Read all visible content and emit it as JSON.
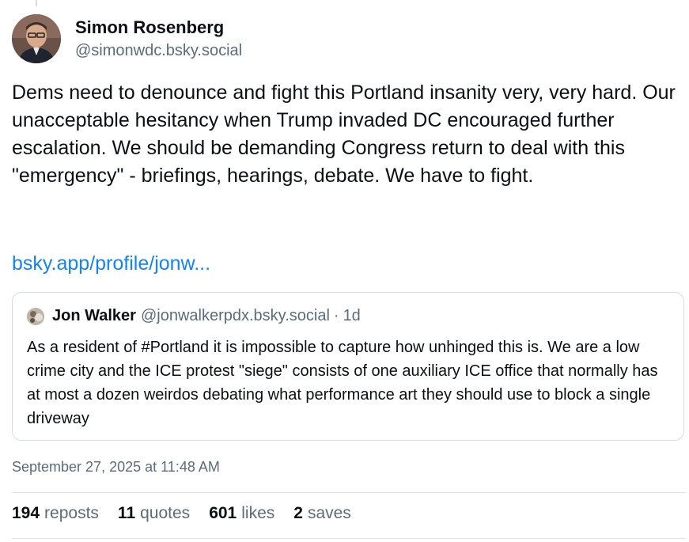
{
  "author": {
    "display_name": "Simon Rosenberg",
    "handle": "@simonwdc.bsky.social"
  },
  "post": {
    "paragraph": "Dems need to denounce and fight this Portland insanity very, very hard.  Our unacceptable hesitancy when Trump invaded DC encouraged further escalation.  We should be demanding Congress return to deal with this \"emergency\" - briefings, hearings, debate.  We have to fight.",
    "link_text": "bsky.app/profile/jonw..."
  },
  "quote": {
    "display_name": "Jon Walker",
    "handle": "@jonwalkerpdx.bsky.social",
    "separator": "·",
    "time": "1d",
    "text": "As a resident of #Portland it is impossible to capture how unhinged this is. We are a low crime city and the ICE protest \"siege\" consists of one auxiliary ICE office that normally has at most a dozen weirdos debating what performance art they should use to block a single driveway"
  },
  "timestamp": "September 27, 2025 at 11:48 AM",
  "stats": {
    "reposts": {
      "count": "194",
      "label": "reposts"
    },
    "quotes": {
      "count": "11",
      "label": "quotes"
    },
    "likes": {
      "count": "601",
      "label": "likes"
    },
    "saves": {
      "count": "2",
      "label": "saves"
    }
  },
  "colors": {
    "link": "#1083fe",
    "secondary_text": "#5b6b7c",
    "border": "#d4dbe2"
  }
}
